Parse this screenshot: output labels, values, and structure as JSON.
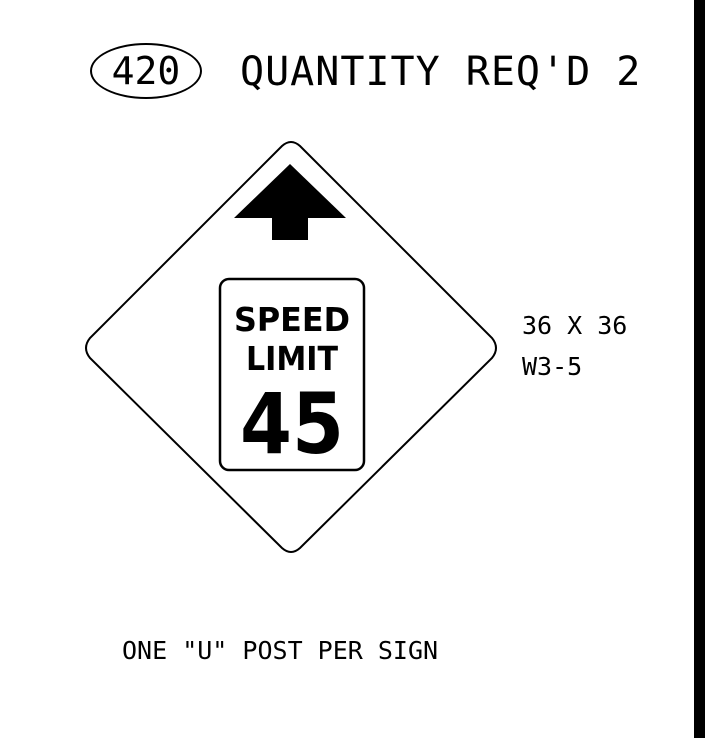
{
  "header": {
    "item_number": "420",
    "quantity_text": "QUANTITY REQ'D 2"
  },
  "sign": {
    "line1": "SPEED",
    "line2": "LIMIT",
    "speed": "45",
    "arrow_icon": "up-arrow-icon"
  },
  "specs": {
    "size": "36 X 36",
    "code": "W3-5"
  },
  "footnote": "ONE \"U\" POST PER SIGN"
}
